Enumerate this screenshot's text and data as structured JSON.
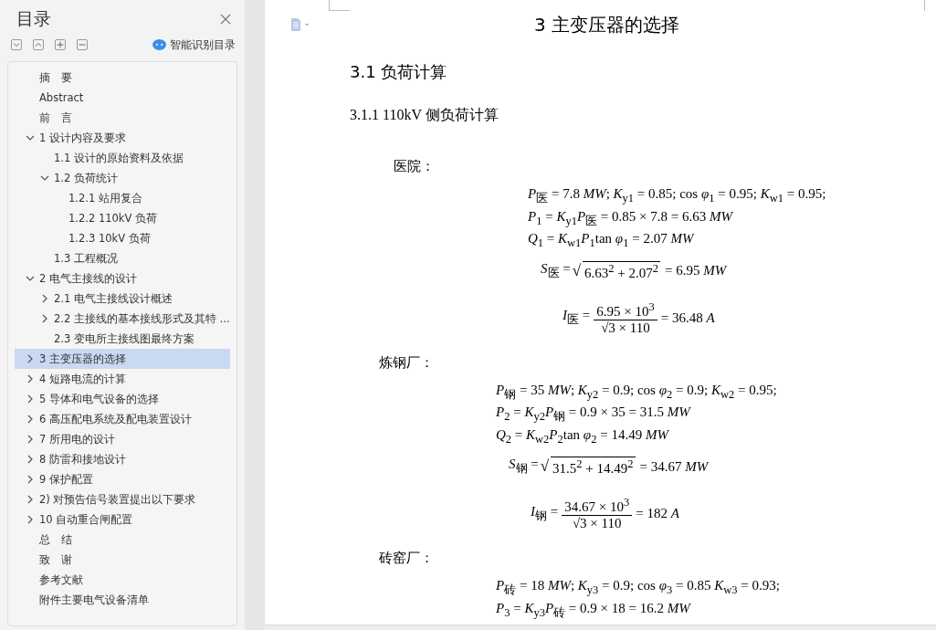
{
  "sidebar": {
    "title": "目录",
    "smart_toc_label": "智能识别目录",
    "items": [
      {
        "label": "摘　要",
        "selected": false
      },
      {
        "label": "Abstract",
        "selected": false
      },
      {
        "label": "前　言",
        "selected": false
      },
      {
        "label": "1  设计内容及要求",
        "selected": false,
        "expanded": true,
        "children": [
          {
            "label": "1.1  设计的原始资料及依据",
            "selected": false
          },
          {
            "label": "1.2  负荷统计",
            "selected": false,
            "expanded": true,
            "children": [
              {
                "label": "1.2.1  站用复合",
                "selected": false
              },
              {
                "label": "1.2.2 110kV 负荷",
                "selected": false
              },
              {
                "label": "1.2.3 10kV 负荷",
                "selected": false
              }
            ]
          },
          {
            "label": "1.3  工程概况",
            "selected": false
          }
        ]
      },
      {
        "label": "2  电气主接线的设计",
        "selected": false,
        "expanded": true,
        "children": [
          {
            "label": "2.1  电气主接线设计概述",
            "selected": false,
            "expanded": false
          },
          {
            "label": "2.2  主接线的基本接线形式及其特 ...",
            "selected": false,
            "expanded": false
          },
          {
            "label": "2.3 变电所主接线图最终方案",
            "selected": false
          }
        ]
      },
      {
        "label": "3  主变压器的选择",
        "selected": true,
        "expanded": false
      },
      {
        "label": "4  短路电流的计算",
        "selected": false,
        "expanded": false
      },
      {
        "label": "5  导体和电气设备的选择",
        "selected": false,
        "expanded": false
      },
      {
        "label": "6  高压配电系统及配电装置设计",
        "selected": false,
        "expanded": false
      },
      {
        "label": "7  所用电的设计",
        "selected": false,
        "expanded": false
      },
      {
        "label": "8  防雷和接地设计",
        "selected": false,
        "expanded": false
      },
      {
        "label": "9  保护配置",
        "selected": false,
        "expanded": false
      },
      {
        "label": "2)  对预告信号装置提出以下要求",
        "selected": false,
        "expanded": false
      },
      {
        "label": "10  自动重合闸配置",
        "selected": false,
        "expanded": false
      },
      {
        "label": "总　结",
        "selected": false
      },
      {
        "label": "致　谢",
        "selected": false
      },
      {
        "label": "参考文献",
        "selected": false
      },
      {
        "label": "附件主要电气设备清单",
        "selected": false
      }
    ]
  },
  "document": {
    "chapter_title": "3  主变压器的选择",
    "section_title": "3.1 负荷计算",
    "subsection_title": "3.1.1 110kV 侧负荷计算",
    "blocks": [
      {
        "label": "医院：",
        "formulas": [
          {
            "kind": "line",
            "text": "*P*$_{医}$ = 7.8 *MW*; *K*$_{y1}$ = 0.85; cos *φ*$_{1}$ = 0.95; *K*$_{w1}$ = 0.95;"
          },
          {
            "kind": "line",
            "text": "*P*$_{1}$ = *K*$_{y1}$*P*$_{医}$ = 0.85 × 7.8 = 6.63 *MW*"
          },
          {
            "kind": "line",
            "text": "*Q*$_{1}$ = *K*$_{w1}$*P*$_{1}$tan *φ*$_{1}$ = 2.07 *MW*"
          },
          {
            "kind": "sqrt",
            "lhs": "*S*$_{医}$ =",
            "radical": "√",
            "radicand": "6.63$^{2}$ + 2.07$^{2}$",
            "rhs": "= 6.95 *MW*"
          },
          {
            "kind": "fraction",
            "lhs": "*I*$_{医}$ =",
            "numerator": "6.95 × 10$^{3}$",
            "denominator": "√3 × 110",
            "rhs": "= 36.48 *A*"
          }
        ]
      },
      {
        "label": "炼钢厂：",
        "formulas": [
          {
            "kind": "line",
            "text": "*P*$_{钢}$ = 35 *MW*; *K*$_{y2}$ = 0.9; cos *φ*$_{2}$ = 0.9; *K*$_{w2}$ = 0.95;"
          },
          {
            "kind": "line",
            "text": "*P*$_{2}$ = *K*$_{y2}$*P*$_{钢}$ = 0.9 × 35 = 31.5 *MW*"
          },
          {
            "kind": "line",
            "text": "*Q*$_{2}$ = *K*$_{w2}$*P*$_{2}$tan *φ*$_{2}$ = 14.49 *MW*"
          },
          {
            "kind": "sqrt",
            "lhs": "*S*$_{钢}$ =",
            "radical": "√",
            "radicand": "31.5$^{2}$ + 14.49$^{2}$",
            "rhs": "= 34.67 *MW*"
          },
          {
            "kind": "fraction",
            "lhs": "*I*$_{钢}$ =",
            "numerator": "34.67 × 10$^{3}$",
            "denominator": "√3 × 110",
            "rhs": "= 182 *A*"
          }
        ]
      },
      {
        "label": "砖窑厂：",
        "formulas": [
          {
            "kind": "line",
            "text": "*P*$_{砖}$ = 18 *MW*; *K*$_{y3}$ = 0.9; cos *φ*$_{3}$ = 0.85 *K*$_{w3}$ = 0.93;"
          },
          {
            "kind": "line",
            "text": "*P*$_{3}$ = *K*$_{y3}$*P*$_{砖}$ = 0.9 × 18 = 16.2 *MW*"
          }
        ]
      }
    ]
  }
}
